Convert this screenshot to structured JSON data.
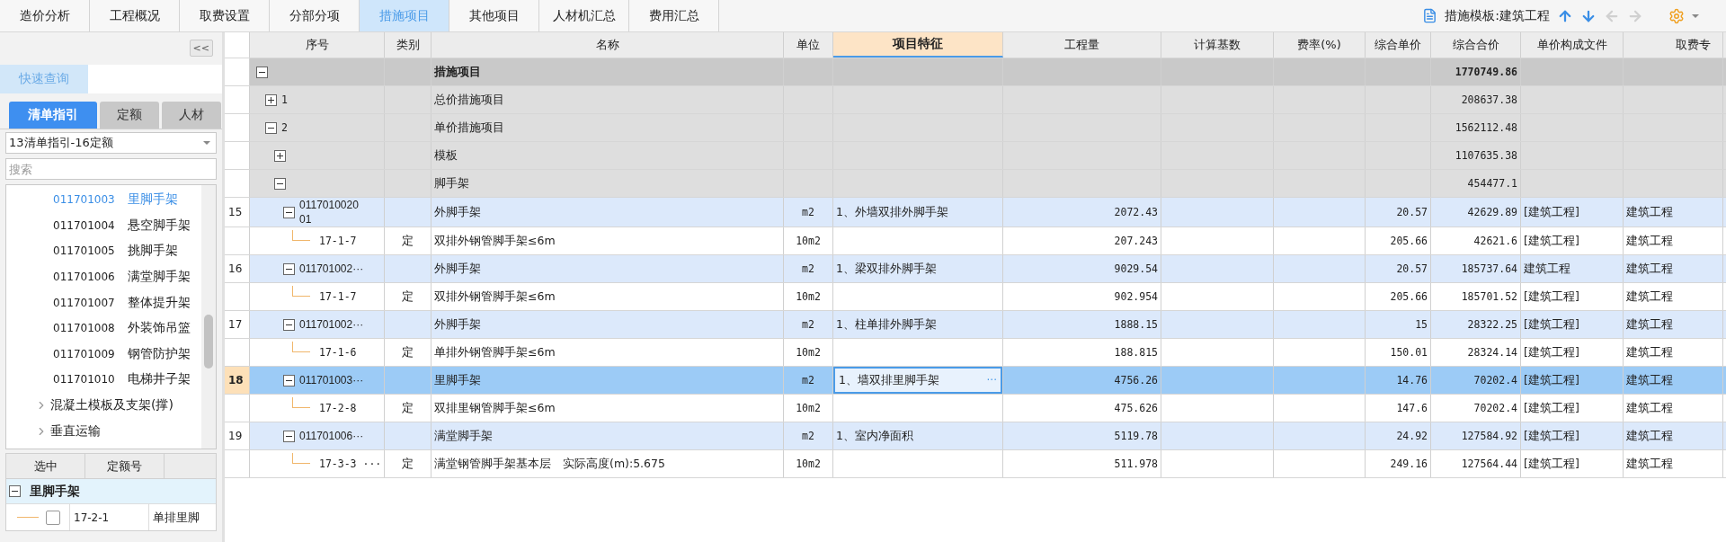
{
  "tabs": [
    {
      "label": "造价分析",
      "selected": false
    },
    {
      "label": "工程概况",
      "selected": false
    },
    {
      "label": "取费设置",
      "selected": false
    },
    {
      "label": "分部分项",
      "selected": false
    },
    {
      "label": "措施项目",
      "selected": true
    },
    {
      "label": "其他项目",
      "selected": false
    },
    {
      "label": "人材机汇总",
      "selected": false
    },
    {
      "label": "费用汇总",
      "selected": false
    }
  ],
  "toolbar": {
    "template_label": "措施模板:建筑工程",
    "nav_buttons": [
      {
        "disabled": false
      },
      {
        "disabled": false
      },
      {
        "disabled": true
      },
      {
        "disabled": true
      }
    ]
  },
  "sidebar": {
    "collapse_button": "<<",
    "quick_tabs": [
      {
        "label": "快速查询",
        "selected": true
      }
    ],
    "tabs": [
      {
        "label": "清单指引",
        "selected": true
      },
      {
        "label": "定额",
        "selected": false
      },
      {
        "label": "人材",
        "selected": false
      }
    ],
    "library": "13清单指引-16定额",
    "search": {
      "placeholder": "搜索"
    },
    "items": [
      {
        "kind": "leaf",
        "code": "011701003",
        "name": "里脚手架",
        "selected": true
      },
      {
        "kind": "leaf",
        "code": "011701004",
        "name": "悬空脚手架",
        "selected": false
      },
      {
        "kind": "leaf",
        "code": "011701005",
        "name": "挑脚手架",
        "selected": false
      },
      {
        "kind": "leaf",
        "code": "011701006",
        "name": "满堂脚手架",
        "selected": false
      },
      {
        "kind": "leaf",
        "code": "011701007",
        "name": "整体提升架",
        "selected": false
      },
      {
        "kind": "leaf",
        "code": "011701008",
        "name": "外装饰吊篮",
        "selected": false
      },
      {
        "kind": "leaf",
        "code": "011701009",
        "name": "钢管防护架",
        "selected": false
      },
      {
        "kind": "leaf",
        "code": "011701010",
        "name": "电梯井子架",
        "selected": false
      },
      {
        "kind": "folder",
        "name": "混凝土模板及支架(撑)",
        "expanded": false,
        "selected": false
      },
      {
        "kind": "folder",
        "name": "垂直运输",
        "expanded": false,
        "selected": false
      }
    ],
    "quota_table": {
      "columns": [
        "选中",
        "定额号"
      ],
      "group": {
        "label": "里脚手架",
        "expanded": true
      },
      "rows": [
        {
          "checked": false,
          "code": "17-2-1",
          "name": "单排里脚"
        }
      ]
    }
  },
  "table": {
    "columns": [
      {
        "label": "序号",
        "selected": false
      },
      {
        "label": "类别",
        "selected": false
      },
      {
        "label": "名称",
        "selected": false
      },
      {
        "label": "单位",
        "selected": false
      },
      {
        "label": "项目特征",
        "selected": true
      },
      {
        "label": "工程量",
        "selected": false
      },
      {
        "label": "计算基数",
        "selected": false
      },
      {
        "label": "费率(%)",
        "selected": false
      },
      {
        "label": "综合单价",
        "selected": false
      },
      {
        "label": "综合合价",
        "selected": false
      },
      {
        "label": "单价构成文件",
        "selected": false
      },
      {
        "label": "取费专",
        "selected": false
      }
    ],
    "edit_button": "···",
    "rows": [
      {
        "kind": "section",
        "name": "措施项目",
        "total": "1770749.86",
        "expanded": true,
        "selected": false,
        "children": [
          {
            "kind": "section",
            "seq": "1",
            "name": "总价措施项目",
            "total": "208637.38",
            "expanded": false,
            "selected": false
          },
          {
            "kind": "section",
            "seq": "2",
            "name": "单价措施项目",
            "total": "1562112.48",
            "expanded": true,
            "selected": false,
            "children": [
              {
                "kind": "section",
                "name": "模板",
                "total": "1107635.38",
                "expanded": false,
                "selected": false
              },
              {
                "kind": "section",
                "name": "脚手架",
                "total": "454477.1",
                "expanded": true,
                "selected": false,
                "children": [
                  {
                    "kind": "item",
                    "row_no": "15",
                    "seq": "011701002001",
                    "name": "外脚手架",
                    "unit": "m2",
                    "feature": "1、外墙双排外脚手架",
                    "qty": "2072.43",
                    "unit_price": "20.57",
                    "total": "42629.89",
                    "file": "[建筑工程]",
                    "fee": "建筑工程",
                    "expanded": true,
                    "selected": false,
                    "children": [
                      {
                        "kind": "quota",
                        "seq": "17-1-7",
                        "type": "定",
                        "name": "双排外钢管脚手架≤6m",
                        "unit": "10m2",
                        "qty": "207.243",
                        "unit_price": "205.66",
                        "total": "42621.6",
                        "file": "[建筑工程]",
                        "fee": "建筑工程",
                        "selected": false
                      }
                    ]
                  },
                  {
                    "kind": "item",
                    "row_no": "16",
                    "seq": "011701002···",
                    "name": "外脚手架",
                    "unit": "m2",
                    "feature": "1、梁双排外脚手架",
                    "qty": "9029.54",
                    "unit_price": "20.57",
                    "total": "185737.64",
                    "file": "建筑工程",
                    "fee": "建筑工程",
                    "expanded": true,
                    "selected": false,
                    "children": [
                      {
                        "kind": "quota",
                        "seq": "17-1-7",
                        "type": "定",
                        "name": "双排外钢管脚手架≤6m",
                        "unit": "10m2",
                        "qty": "902.954",
                        "unit_price": "205.66",
                        "total": "185701.52",
                        "file": "[建筑工程]",
                        "fee": "建筑工程",
                        "selected": false
                      }
                    ]
                  },
                  {
                    "kind": "item",
                    "row_no": "17",
                    "seq": "011701002···",
                    "name": "外脚手架",
                    "unit": "m2",
                    "feature": "1、柱单排外脚手架",
                    "qty": "1888.15",
                    "unit_price": "15",
                    "total": "28322.25",
                    "file": "[建筑工程]",
                    "fee": "建筑工程",
                    "expanded": true,
                    "selected": false,
                    "children": [
                      {
                        "kind": "quota",
                        "seq": "17-1-6",
                        "type": "定",
                        "name": "单排外钢管脚手架≤6m",
                        "unit": "10m2",
                        "qty": "188.815",
                        "unit_price": "150.01",
                        "total": "28324.14",
                        "file": "[建筑工程]",
                        "fee": "建筑工程",
                        "selected": false
                      }
                    ]
                  },
                  {
                    "kind": "item",
                    "row_no": "18",
                    "seq": "011701003···",
                    "name": "里脚手架",
                    "unit": "m2",
                    "feature": "1、墙双排里脚手架",
                    "qty": "4756.26",
                    "unit_price": "14.76",
                    "total": "70202.4",
                    "file": "[建筑工程]",
                    "fee": "建筑工程",
                    "expanded": true,
                    "selected": true,
                    "children": [
                      {
                        "kind": "quota",
                        "seq": "17-2-8",
                        "type": "定",
                        "name": "双排里钢管脚手架≤6m",
                        "unit": "10m2",
                        "qty": "475.626",
                        "unit_price": "147.6",
                        "total": "70202.4",
                        "file": "[建筑工程]",
                        "fee": "建筑工程",
                        "selected": false
                      }
                    ]
                  },
                  {
                    "kind": "item",
                    "row_no": "19",
                    "seq": "011701006···",
                    "name": "满堂脚手架",
                    "unit": "m2",
                    "feature": "1、室内净面积",
                    "qty": "5119.78",
                    "unit_price": "24.92",
                    "total": "127584.92",
                    "file": "[建筑工程]",
                    "fee": "建筑工程",
                    "expanded": true,
                    "selected": false,
                    "children": [
                      {
                        "kind": "quota",
                        "seq": "17-3-3 ···",
                        "type": "定",
                        "name": "满堂钢管脚手架基本层　实际高度(m):5.675",
                        "unit": "10m2",
                        "qty": "511.978",
                        "unit_price": "249.16",
                        "total": "127564.44",
                        "file": "[建筑工程]",
                        "fee": "建筑工程",
                        "selected": false
                      }
                    ]
                  }
                ]
              }
            ]
          }
        ]
      }
    ]
  }
}
